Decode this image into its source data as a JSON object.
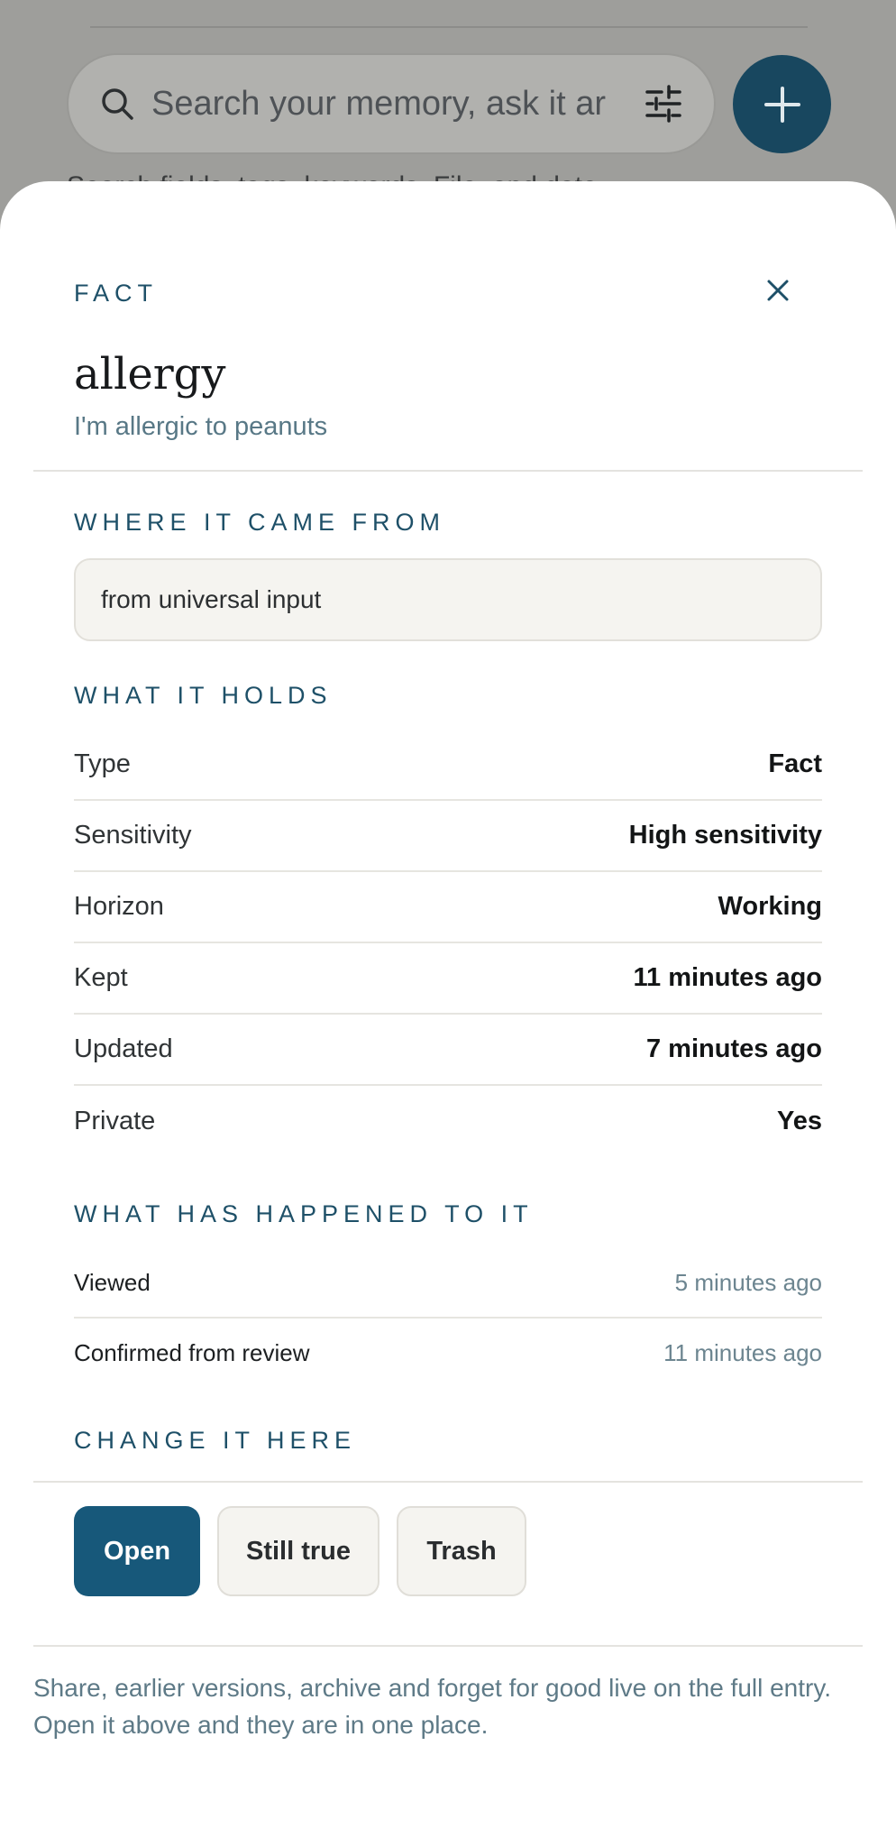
{
  "background": {
    "search_placeholder": "Search your memory, ask it ar",
    "peek_text": "Search fields, tags, keywords, File, and date"
  },
  "sheet": {
    "kicker": "FACT",
    "title": "allergy",
    "subtitle": "I'm allergic to peanuts",
    "source": {
      "heading": "WHERE IT CAME FROM",
      "value": "from universal input"
    },
    "holds": {
      "heading": "WHAT IT HOLDS",
      "rows": [
        {
          "label": "Type",
          "value": "Fact"
        },
        {
          "label": "Sensitivity",
          "value": "High sensitivity"
        },
        {
          "label": "Horizon",
          "value": "Working"
        },
        {
          "label": "Kept",
          "value": "11 minutes ago"
        },
        {
          "label": "Updated",
          "value": "7 minutes ago"
        },
        {
          "label": "Private",
          "value": "Yes"
        }
      ]
    },
    "history": {
      "heading": "WHAT HAS HAPPENED TO IT",
      "events": [
        {
          "label": "Viewed",
          "time": "5 minutes ago"
        },
        {
          "label": "Confirmed from review",
          "time": "11 minutes ago"
        }
      ]
    },
    "change": {
      "heading": "CHANGE IT HERE",
      "open_label": "Open",
      "still_true_label": "Still true",
      "trash_label": "Trash"
    },
    "footer_note": "Share, earlier versions, archive and forget for good live on the full entry. Open it above and they are in one place."
  },
  "colors": {
    "accent": "#17587a",
    "kicker": "#1e5068",
    "muted": "#587886"
  }
}
